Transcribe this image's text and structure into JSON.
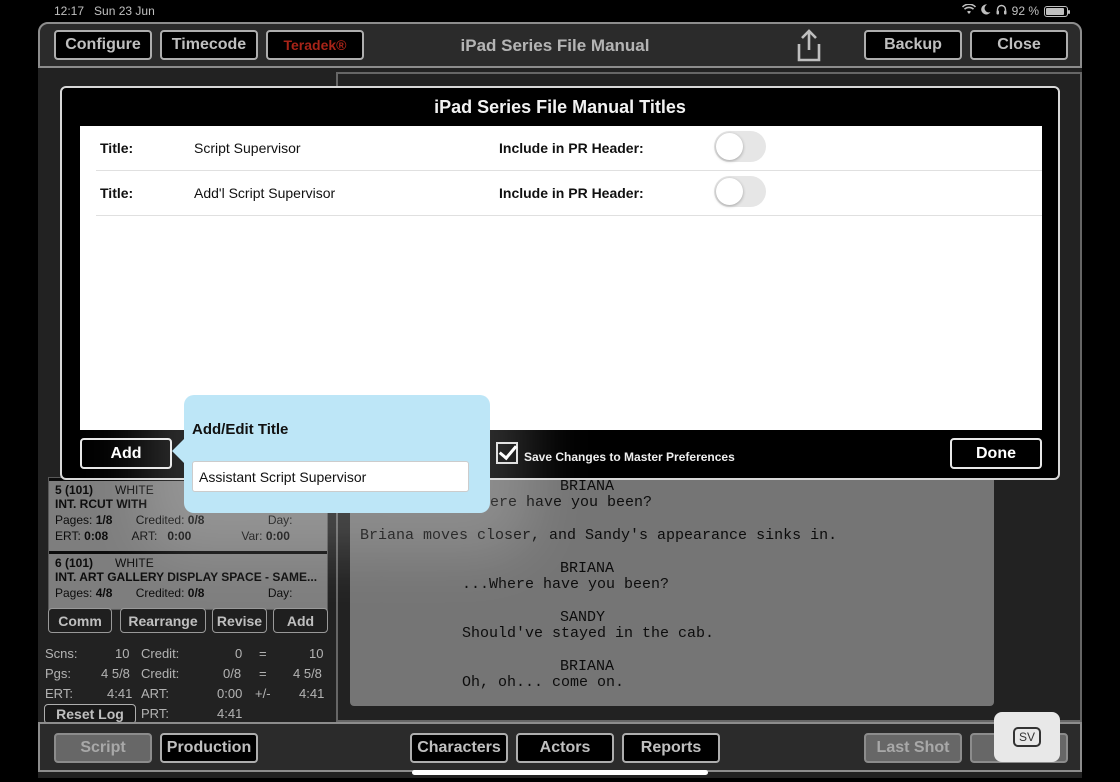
{
  "status": {
    "time": "12:17",
    "date": "Sun 23 Jun",
    "battery": "92 %",
    "battery_level": 0.92
  },
  "topbar": {
    "configure": "Configure",
    "timecode": "Timecode",
    "teradek": "Teradek®",
    "title": "iPad Series File Manual",
    "backup": "Backup",
    "close": "Close"
  },
  "scenes": [
    {
      "num": "5 (101)",
      "color": "WHITE",
      "slug": "INT. RCUT WITH",
      "pages_label": "Pages:",
      "pages": "1/8",
      "credited_label": "Credited:",
      "credited": "0/8",
      "day_label": "Day:",
      "ert_label": "ERT:",
      "ert": "0:08",
      "art_label": "ART:",
      "art": "0:00",
      "var_label": "Var:",
      "var": "0:00"
    },
    {
      "num": "6 (101)",
      "color": "WHITE",
      "slug": "INT. ART GALLERY DISPLAY SPACE - SAME...",
      "pages_label": "Pages:",
      "pages": "4/8",
      "credited_label": "Credited:",
      "credited": "0/8",
      "day_label": "Day:"
    }
  ],
  "leftbuttons": {
    "comm": "Comm",
    "rearrange": "Rearrange",
    "revise": "Revise",
    "add": "Add"
  },
  "stats": {
    "scns_label": "Scns:",
    "scns": "10",
    "credit_label": "Credit:",
    "credit1": "0",
    "eq": "=",
    "total1": "10",
    "pgs_label": "Pgs:",
    "pgs": "4 5/8",
    "credit2": "0/8",
    "total2": "4 5/8",
    "ert_label": "ERT:",
    "ert": "4:41",
    "art_label": "ART:",
    "art": "0:00",
    "pm": "+/-",
    "total3": "4:41",
    "reset": "Reset Log",
    "prt_label": "PRT:",
    "prt": "4:41"
  },
  "script_lines": [
    {
      "text": "BRIANA"
    },
    {
      "text": "ere have you been?"
    },
    {
      "text": "Briana moves closer, and Sandy's appearance sinks in."
    },
    {
      "text": "BRIANA"
    },
    {
      "text": "...Where have you been?"
    },
    {
      "text": "SANDY"
    },
    {
      "text": "Should've stayed in the cab."
    },
    {
      "text": "BRIANA"
    },
    {
      "text": "Oh, oh... come on."
    }
  ],
  "bottombar": {
    "script": "Script",
    "production": "Production",
    "characters": "Characters",
    "actors": "Actors",
    "reports": "Reports",
    "last_shot": "Last Shot",
    "sv": "SV"
  },
  "modal": {
    "title": "iPad Series File Manual Titles",
    "rows": [
      {
        "label": "Title:",
        "value": "Script Supervisor",
        "include_label": "Include in PR Header:",
        "include": false
      },
      {
        "label": "Title:",
        "value": "Add'l Script Supervisor",
        "include_label": "Include in PR Header:",
        "include": false
      }
    ],
    "add": "Add",
    "save_label": "Save Changes to Master Preferences",
    "save_checked": true,
    "done": "Done"
  },
  "popover": {
    "title": "Add/Edit Title",
    "input_value": "Assistant Script Supervisor"
  }
}
